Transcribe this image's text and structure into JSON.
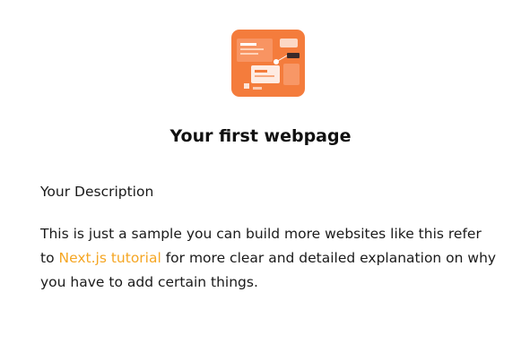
{
  "page": {
    "title": "Your first webpage",
    "description_heading": "Your Description",
    "body": {
      "before_link": "This is just a sample you can build more websites like this refer to ",
      "link_text": "Next.js tutorial",
      "after_link": " for more clear and detailed explanation on why you have to add certain things."
    }
  },
  "hero_image": {
    "icon": "web-design-illustration-icon",
    "background_color": "#f47c3c",
    "accent_color": "#ffffff"
  },
  "colors": {
    "link": "#f5a623",
    "text": "#1a1a1a"
  }
}
